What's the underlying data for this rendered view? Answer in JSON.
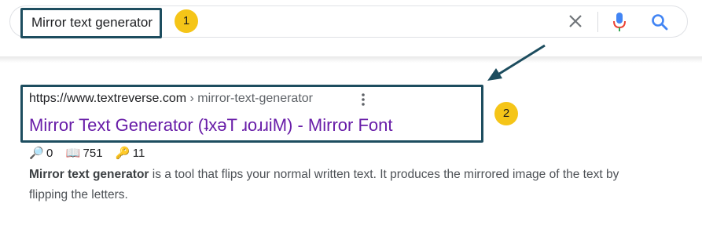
{
  "search": {
    "query": "Mirror text generator"
  },
  "annotations": [
    "1",
    "2"
  ],
  "result": {
    "url_host": "https://www.textreverse.com",
    "url_sep": " › ",
    "url_path": "mirror-text-generator",
    "title": "Mirror Text Generator (ʇxǝT ɹoɹɹiM) - Mirror Font",
    "stats": [
      {
        "icon": "magnifier-icon",
        "glyph": "🔎",
        "value": "0"
      },
      {
        "icon": "book-icon",
        "glyph": "📖",
        "value": "751"
      },
      {
        "icon": "key-icon",
        "glyph": "🔑",
        "value": "11"
      }
    ],
    "snippet_bold": "Mirror text generator",
    "snippet_rest": " is a tool that flips your normal written text. It produces the mirrored image of the text by flipping the letters."
  },
  "colors": {
    "annotation_border": "#1d4d5f",
    "badge": "#f5c518",
    "title_link": "#681da8",
    "google_blue": "#4285f4",
    "google_red": "#ea4335"
  }
}
